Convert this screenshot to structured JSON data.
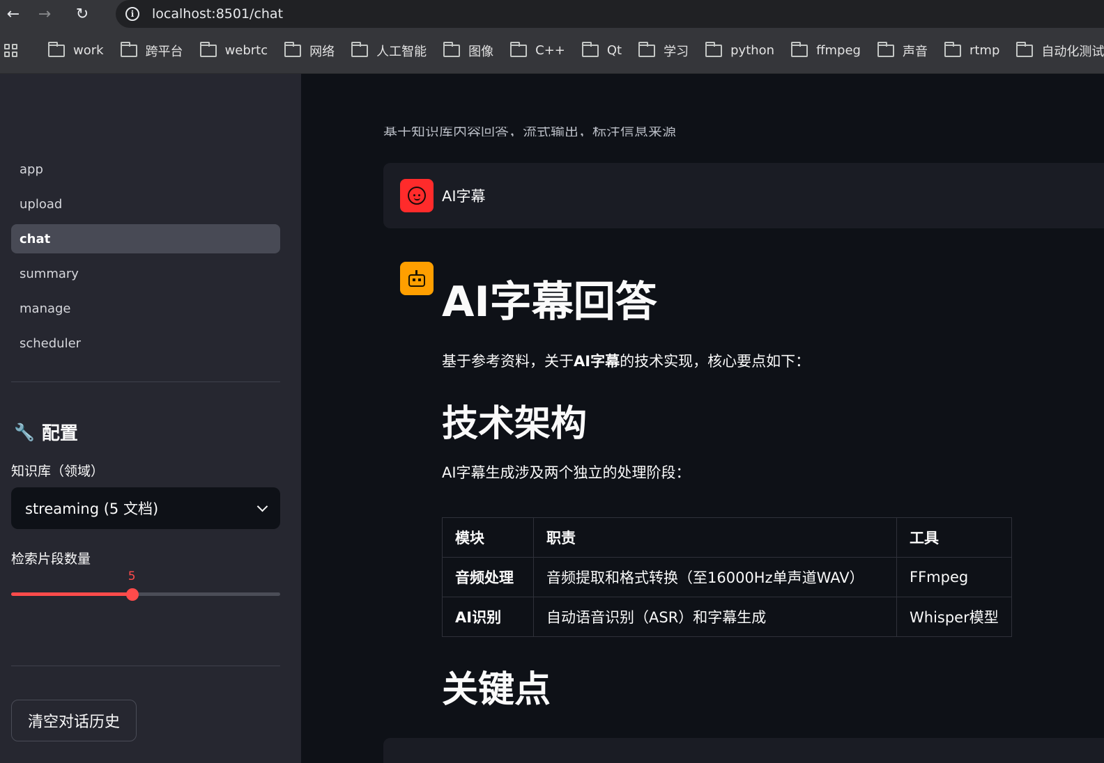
{
  "browser": {
    "url": "localhost:8501/chat",
    "bookmarks": [
      "work",
      "跨平台",
      "webrtc",
      "网络",
      "人工智能",
      "图像",
      "C++",
      "Qt",
      "学习",
      "python",
      "ffmpeg",
      "声音",
      "rtmp",
      "自动化测试"
    ]
  },
  "sidebar": {
    "nav": [
      {
        "label": "app"
      },
      {
        "label": "upload"
      },
      {
        "label": "chat",
        "active": true
      },
      {
        "label": "summary"
      },
      {
        "label": "manage"
      },
      {
        "label": "scheduler"
      }
    ],
    "config_title": "配置",
    "kb_label": "知识库（领域）",
    "kb_value": "streaming (5 文档)",
    "chunks_label": "检索片段数量",
    "chunks_value": "5",
    "chunks_fraction": 0.45,
    "clear_button": "清空对话历史"
  },
  "main": {
    "caption": "基于知识库内容回答，流式输出，标注信息来源",
    "user_message": "AI字幕",
    "answer": {
      "h1": "AI字幕回答",
      "intro_prefix": "基于参考资料，关于",
      "intro_bold": "AI字幕",
      "intro_suffix": "的技术实现，核心要点如下：",
      "h2_arch": "技术架构",
      "arch_desc": "AI字幕生成涉及两个独立的处理阶段：",
      "table": {
        "headers": [
          "模块",
          "职责",
          "工具"
        ],
        "rows": [
          [
            "音频处理",
            "音频提取和格式转换（至16000Hz单声道WAV）",
            "FFmpeg"
          ],
          [
            "AI识别",
            "自动语音识别（ASR）和字幕生成",
            "Whisper模型"
          ]
        ]
      },
      "h2_key": "关键点"
    }
  },
  "colors": {
    "accent": "#ff4b4b",
    "sidebar_bg": "#262730",
    "main_bg": "#0e1117",
    "user_avatar": "#ff2b2b",
    "bot_avatar": "#ff9f00"
  }
}
